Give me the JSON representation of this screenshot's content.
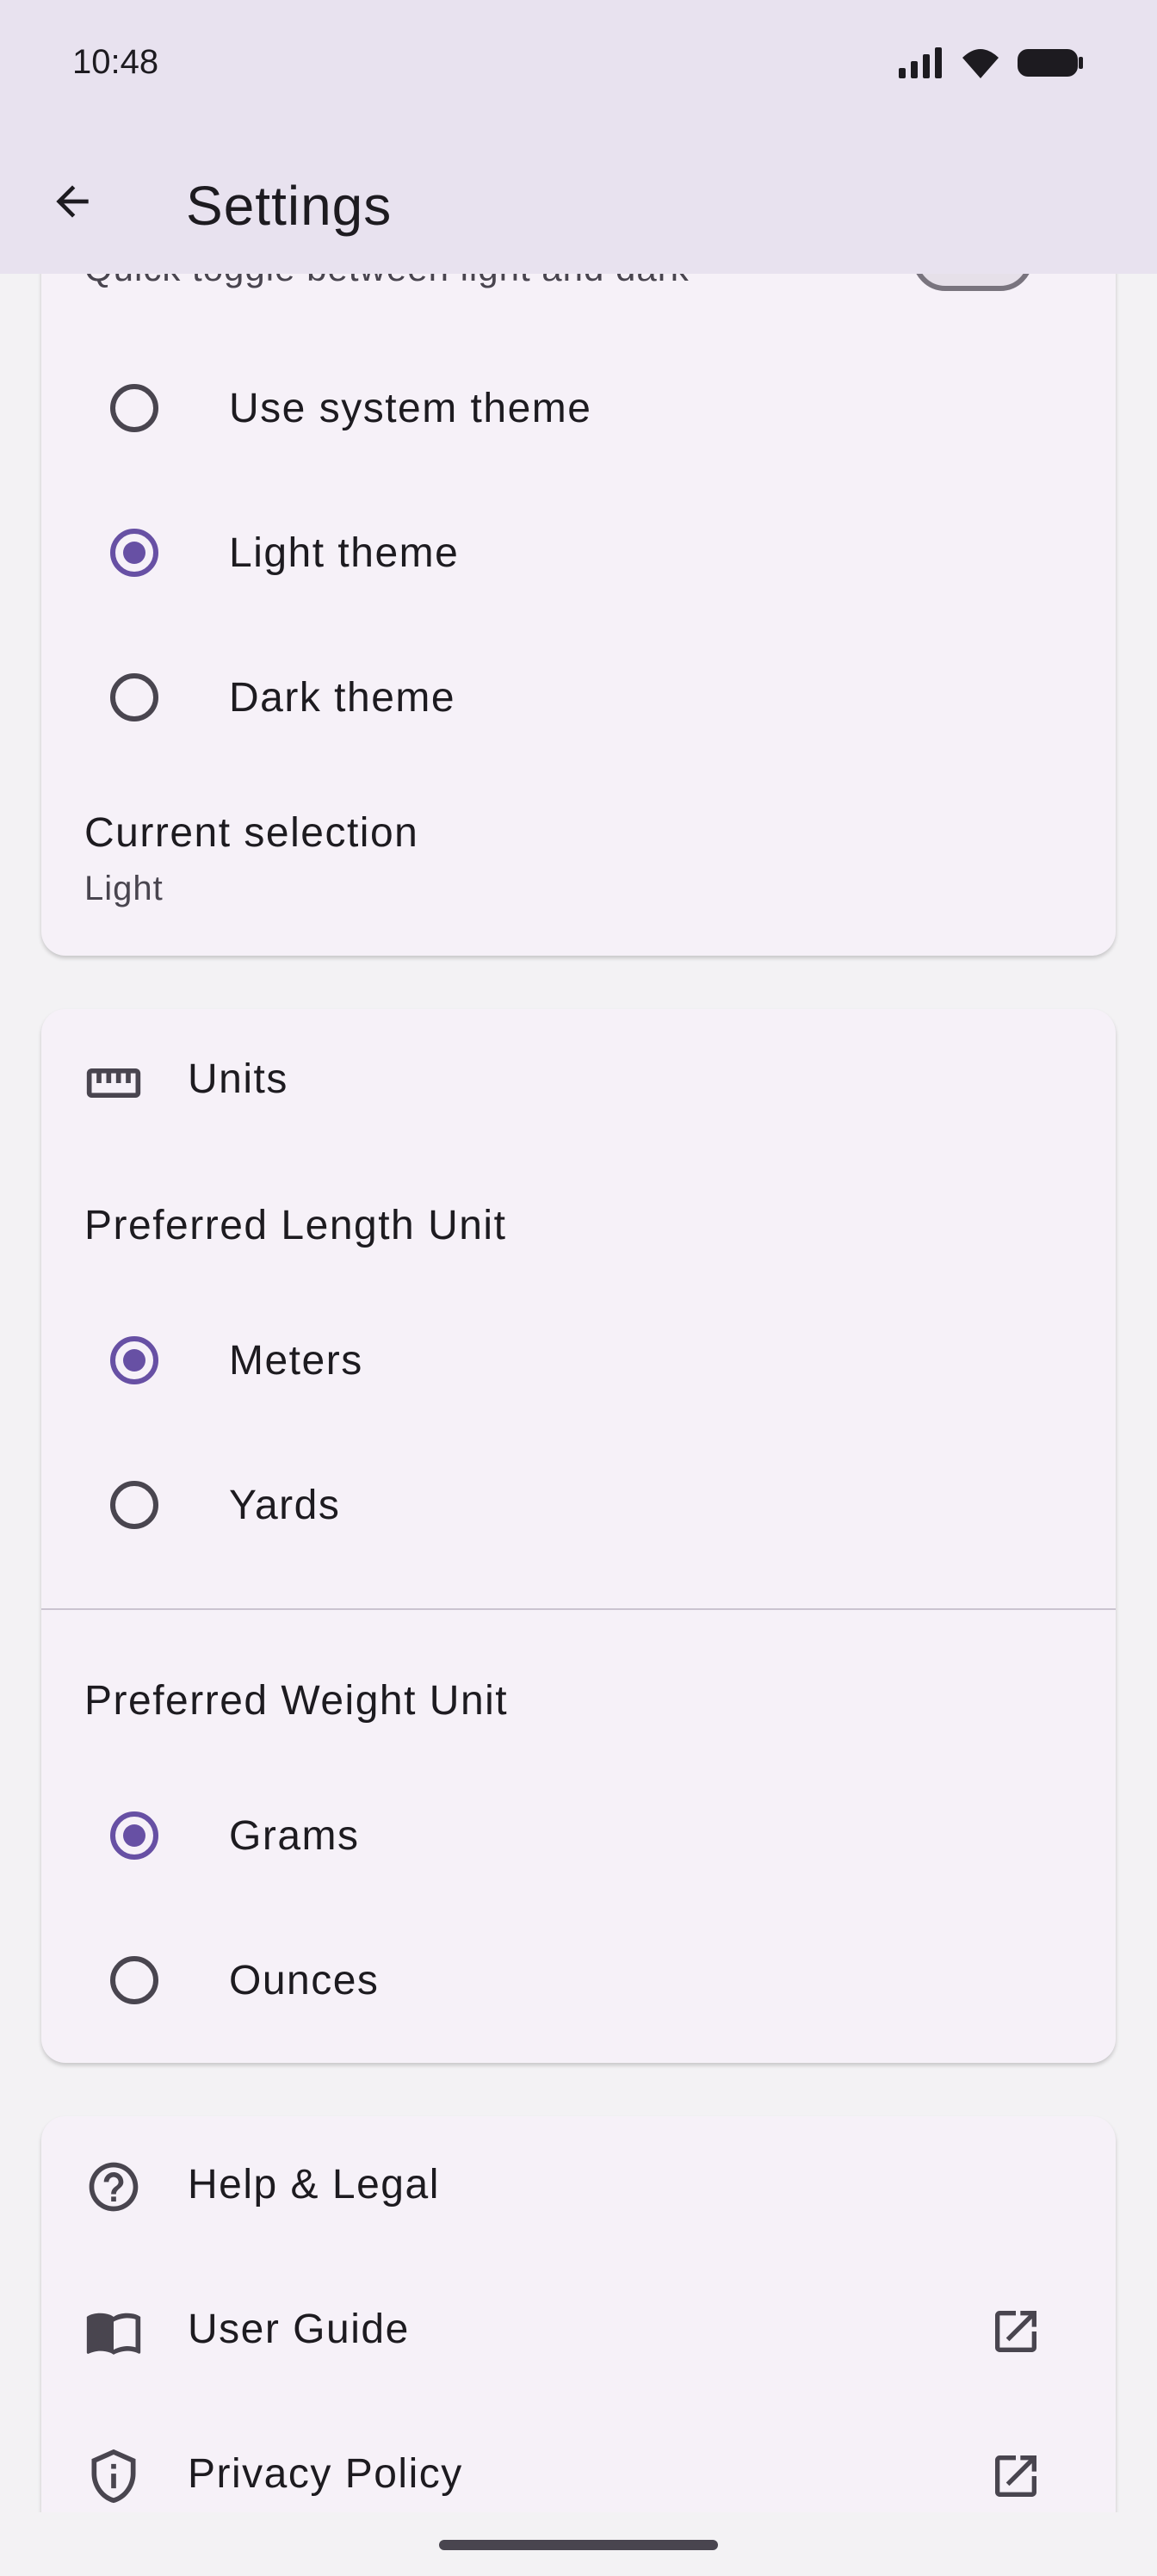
{
  "status_bar": {
    "time": "10:48"
  },
  "app_bar": {
    "title": "Settings"
  },
  "theme_card": {
    "subtitle_cut": "Quick toggle between light and dark",
    "options": [
      {
        "label": "Use system theme",
        "checked": false
      },
      {
        "label": "Light theme",
        "checked": true
      },
      {
        "label": "Dark theme",
        "checked": false
      }
    ],
    "current_selection_label": "Current selection",
    "current_selection_value": "Light"
  },
  "units_card": {
    "header": "Units",
    "length_heading": "Preferred Length Unit",
    "length_options": [
      {
        "label": "Meters",
        "checked": true
      },
      {
        "label": "Yards",
        "checked": false
      }
    ],
    "weight_heading": "Preferred Weight Unit",
    "weight_options": [
      {
        "label": "Grams",
        "checked": true
      },
      {
        "label": "Ounces",
        "checked": false
      }
    ]
  },
  "help_card": {
    "header": "Help & Legal",
    "items": [
      {
        "label": "User Guide",
        "icon": "book-icon"
      },
      {
        "label": "Privacy Policy",
        "icon": "shield-icon"
      }
    ]
  },
  "colors": {
    "accent": "#6750a4",
    "app_bar": "#e8e2ef",
    "card": "#f6f1f8"
  }
}
